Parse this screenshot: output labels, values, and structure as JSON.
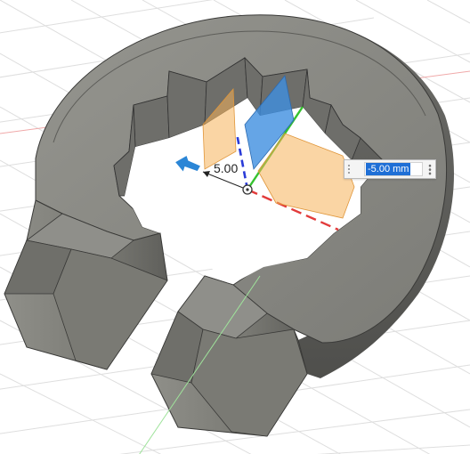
{
  "viewport": {
    "dimension_label": "5.00",
    "dimension_input": {
      "value": "-5.00 mm"
    },
    "colors": {
      "body_face": "#8a8a86",
      "body_side": "#6d6d69",
      "grid_line": "#dcdcdc",
      "axis_x": "#e23b3b",
      "axis_y": "#35c22f",
      "axis_z": "#2a3bd8",
      "plane_orange": "#f6b25a",
      "plane_blue": "#3f8fe0",
      "manipulator_arrow": "#2b86d6"
    },
    "icons": [
      "move-arrow-icon",
      "origin-point-icon",
      "grip-icon",
      "options-menu-icon"
    ]
  }
}
